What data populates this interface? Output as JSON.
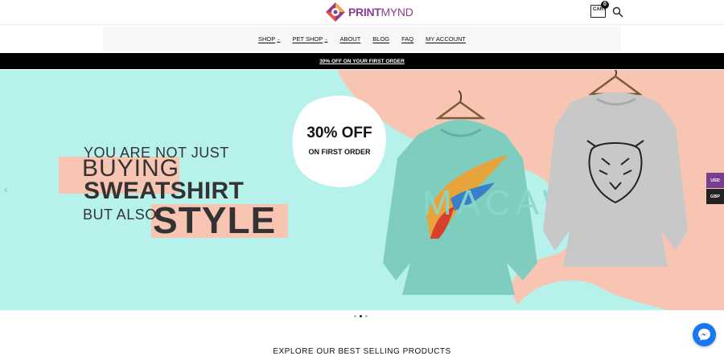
{
  "brand": {
    "name_bold": "PRINT",
    "name_thin": "MYND"
  },
  "header": {
    "cart_label": "CART",
    "cart_count": "0"
  },
  "nav": {
    "items": [
      {
        "label": "SHOP",
        "has_dropdown": true
      },
      {
        "label": "PET SHOP",
        "has_dropdown": true
      },
      {
        "label": "ABOUT",
        "has_dropdown": false
      },
      {
        "label": "BLOG",
        "has_dropdown": false
      },
      {
        "label": "FAQ",
        "has_dropdown": false
      },
      {
        "label": "MY ACCOUNT",
        "has_dropdown": false
      }
    ]
  },
  "announcement": {
    "text": "30% OFF ON YOUR FIRST ORDER"
  },
  "hero": {
    "line1": "YOU ARE NOT JUST",
    "line2": "BUYING",
    "line3": "SWEATSHIRT",
    "line4": "BUT ALSO",
    "line5": "STYLE",
    "badge_big": "30% OFF",
    "badge_small": "ON FIRST ORDER",
    "sweatshirt_print": "MACAW"
  },
  "currency": {
    "usd": "USD",
    "gbp": "GBP"
  },
  "carousel": {
    "slide_count": 3,
    "active_index": 1
  },
  "section": {
    "title": "EXPLORE OUR BEST SELLING PRODUCTS"
  },
  "colors": {
    "accent": "#7a3e8e",
    "hero_mint": "#b6f1ec",
    "hero_peach": "#f8c5b3",
    "messenger": "#1877f2"
  }
}
